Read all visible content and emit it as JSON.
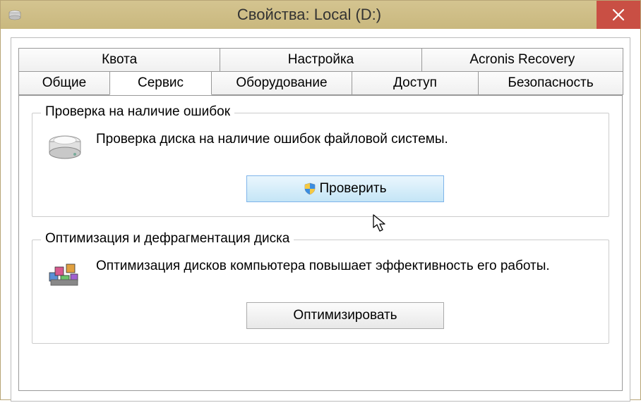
{
  "window": {
    "title": "Свойства: Local (D:)"
  },
  "tabs": {
    "row1": [
      "Квота",
      "Настройка",
      "Acronis Recovery"
    ],
    "row2": [
      "Общие",
      "Сервис",
      "Оборудование",
      "Доступ",
      "Безопасность"
    ],
    "active": "Сервис"
  },
  "group_check": {
    "title": "Проверка на наличие ошибок",
    "text": "Проверка диска на наличие ошибок файловой системы.",
    "button": "Проверить"
  },
  "group_optimize": {
    "title": "Оптимизация и дефрагментация диска",
    "text": "Оптимизация дисков компьютера повышает эффективность его работы.",
    "button": "Оптимизировать"
  }
}
